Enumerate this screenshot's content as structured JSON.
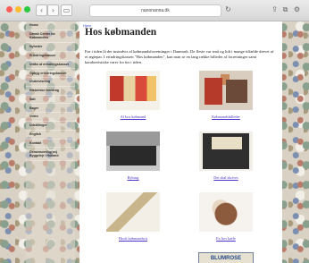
{
  "browser": {
    "url": "nanonanna.dk",
    "back_icon": "chevron-left-icon",
    "forward_icon": "chevron-right-icon"
  },
  "sidebar": {
    "items": [
      {
        "label": "Home"
      },
      {
        "label": "Dansk Center for\nKøbmanden"
      },
      {
        "label": "Nyheder"
      },
      {
        "label": "Erindringskasser"
      },
      {
        "label": "Udlån af erindringskasser"
      },
      {
        "label": "Opbyg erindringskasser"
      },
      {
        "label": "Undervisning"
      },
      {
        "label": "Historiske foredrag"
      },
      {
        "label": "Salt"
      },
      {
        "label": "Bager"
      },
      {
        "label": "Video"
      },
      {
        "label": "Udstillinger"
      },
      {
        "label": "English"
      },
      {
        "label": "Kontakt"
      },
      {
        "label": "Demensvenlig(en)\nByggelejr i Holland"
      }
    ]
  },
  "content": {
    "breadcrumb": "Hjem",
    "title": "Hos købmanden",
    "intro": "Før i tiden lå der tusindvis af købmandsforretninger i Danmark. De fleste var små og lidt i mange tilfælde drevet af et ægtepar. I erindringskassen \"Hos købmanden\", kan man se en lang række billeder af forretninger samt karakteristiske varer fra før i tiden.",
    "gallery": [
      {
        "caption": "Af hos købmand"
      },
      {
        "caption": "Købmandsbilleder"
      },
      {
        "caption": "Bybrug"
      },
      {
        "caption": "Det skal skrives"
      },
      {
        "caption": "Hook købmandsrit"
      },
      {
        "caption": "Ex hos kaffe"
      },
      {
        "caption": ""
      },
      {
        "caption": "BLUMROSE"
      }
    ]
  }
}
